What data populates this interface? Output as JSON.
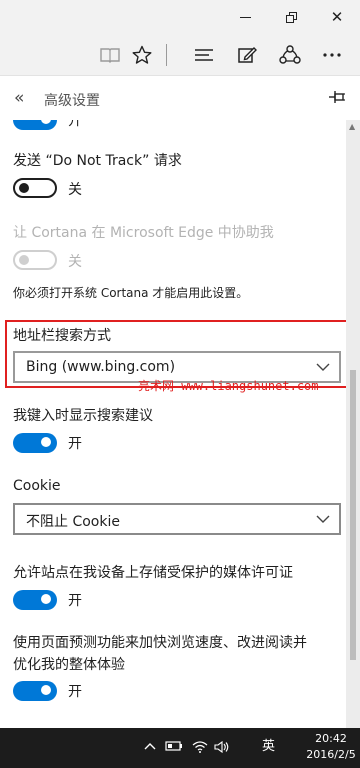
{
  "window": {
    "minimize_label": "—",
    "close_label": "✕"
  },
  "toolbar": {
    "icons": [
      "reading-view-icon",
      "favorite-star-icon",
      "hub-icon",
      "web-note-icon",
      "share-icon",
      "more-icon"
    ]
  },
  "panel": {
    "back_label": "«",
    "title": "高级设置",
    "pin_icon": "pin-icon"
  },
  "settings": {
    "top_toggle_text": "开",
    "dnt": {
      "label": "发送 “Do Not Track” 请求",
      "state_text": "关"
    },
    "cortana": {
      "label": "让 Cortana 在 Microsoft Edge 中协助我",
      "state_text": "关",
      "note": "你必须打开系统 Cortana 才能启用此设置。"
    },
    "search": {
      "label": "地址栏搜索方式",
      "value": "Bing (www.bing.com)"
    },
    "suggest": {
      "label": "我键入时显示搜索建议",
      "state_text": "开"
    },
    "cookie": {
      "label": "Cookie",
      "value": "不阻止 Cookie"
    },
    "media": {
      "label": "允许站点在我设备上存储受保护的媒体许可证",
      "state_text": "开"
    },
    "predict": {
      "label_line1": "使用页面预测功能来加快浏览速度、改进阅读并",
      "label_line2": "优化我的整体体验",
      "state_text": "开"
    }
  },
  "watermark": "亮术网 www.liangshunet.com",
  "taskbar": {
    "ime": "英",
    "time": "20:42",
    "date": "2016/2/5"
  },
  "colors": {
    "accent": "#0078d7",
    "highlight_border": "#e02020",
    "taskbar": "#1c1c1c"
  }
}
